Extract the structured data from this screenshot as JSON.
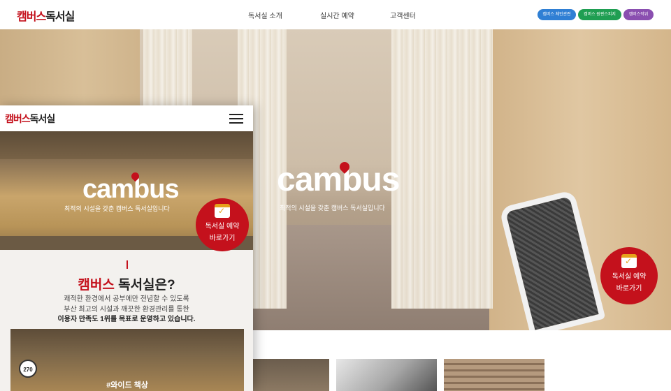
{
  "header": {
    "logo_red": "캠버스",
    "logo_dark": "독서실",
    "nav": [
      {
        "label": "독서실 소개"
      },
      {
        "label": "실시간 예약"
      },
      {
        "label": "고객센터"
      }
    ],
    "pills": [
      {
        "label": "캠버스 체인관련",
        "color": "#2f7fd4"
      },
      {
        "label": "캠버스 원판스피지",
        "color": "#1f9e52"
      },
      {
        "label": "캠버스작위",
        "color": "#8a4fb0"
      }
    ]
  },
  "hero": {
    "brand": "cambus",
    "subtitle": "최적의 시설을 갖춘 캠버스 독서실입니다",
    "cta_line1": "독서실 예약",
    "cta_line2": "바로가기"
  },
  "mobile": {
    "logo_red": "캠버스",
    "logo_dark": "독서실",
    "brand": "cambus",
    "subtitle": "최적의 시설을 갖춘 캠버스 독서실입니다",
    "cta_line1": "독서실 예약",
    "cta_line2": "바로가기",
    "intro_title_red": "캠버스",
    "intro_title_dark": " 독서실은?",
    "intro_line1": "쾌적한 환경에서 공부에만 전념할 수 있도록",
    "intro_line2": "부산 최고의 시설과 깨끗한 환경관리를 통한",
    "intro_line3": "이용자 만족도 1위를 목표로 운영하고 있습니다.",
    "card_badge": "270",
    "card_caption": "#와이드 책상"
  },
  "colors": {
    "brand_red": "#c4111c",
    "calendar_yellow": "#e6a21b"
  }
}
